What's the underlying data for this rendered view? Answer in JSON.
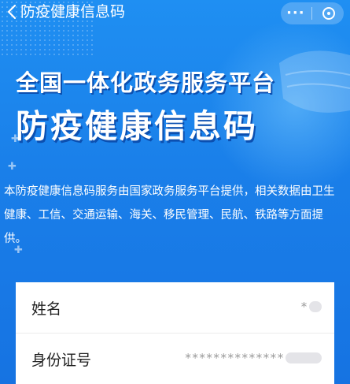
{
  "nav": {
    "back_icon": "chevron-left-icon",
    "title": "防疫健康信息码",
    "more_label": "···",
    "close_icon": "close-circle-icon"
  },
  "hero": {
    "title_line1": "全国一体化政务服务平台",
    "title_line2": "防疫健康信息码",
    "description": "本防疫健康信息码服务由国家政务服务平台提供，相关数据由卫生健康、工信、交通运输、海关、移民管理、民航、铁路等方面提供。"
  },
  "form": {
    "name_label": "姓名",
    "name_value": "*",
    "id_label": "身份证号",
    "id_value": "**************"
  },
  "colors": {
    "brand_blue": "#1a7fe9",
    "card_bg": "#ffffff",
    "page_bg": "#f2f3f5"
  }
}
